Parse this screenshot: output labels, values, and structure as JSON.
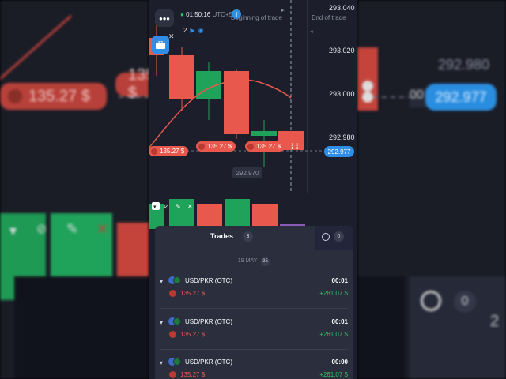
{
  "background": {
    "left_pill_amount": "135.27 $",
    "left_pill2_amount": "135.27 $",
    "right_price": "292.980",
    "right_pill_price": "292.977",
    "right_clock_count": "0",
    "right_edge_digit": "2"
  },
  "chart": {
    "menu_icon": "more-horizontal-icon",
    "timer": "01:50:16",
    "utc": "UTC+5",
    "info_label": "i",
    "counter_value": "2",
    "beginning_label": "Beginning of trade",
    "end_label": "End of trade",
    "prices": [
      "293.040",
      "293.020",
      "293.000",
      "292.980"
    ],
    "current_price": "292.977",
    "hover_price": "292.970",
    "trade_tags": [
      "135.27 $",
      "135.27 $",
      "135.27 $"
    ],
    "colors": {
      "up": "#1fa35a",
      "down": "#e8584c",
      "accent": "#2f8ee6"
    }
  },
  "trades_panel": {
    "tab_label": "Trades",
    "tab_count": "3",
    "closed_count": "0",
    "date_label": "19 MAY",
    "date_count": "35",
    "items": [
      {
        "pair": "USD/PKR (OTC)",
        "time": "00:01",
        "amount": "135.27 $",
        "profit": "+261.07 $"
      },
      {
        "pair": "USD/PKR (OTC)",
        "time": "00:01",
        "amount": "135.27 $",
        "profit": "+261.07 $"
      },
      {
        "pair": "USD/PKR (OTC)",
        "time": "00:00",
        "amount": "135.27 $",
        "profit": "+261.07 $"
      }
    ]
  }
}
